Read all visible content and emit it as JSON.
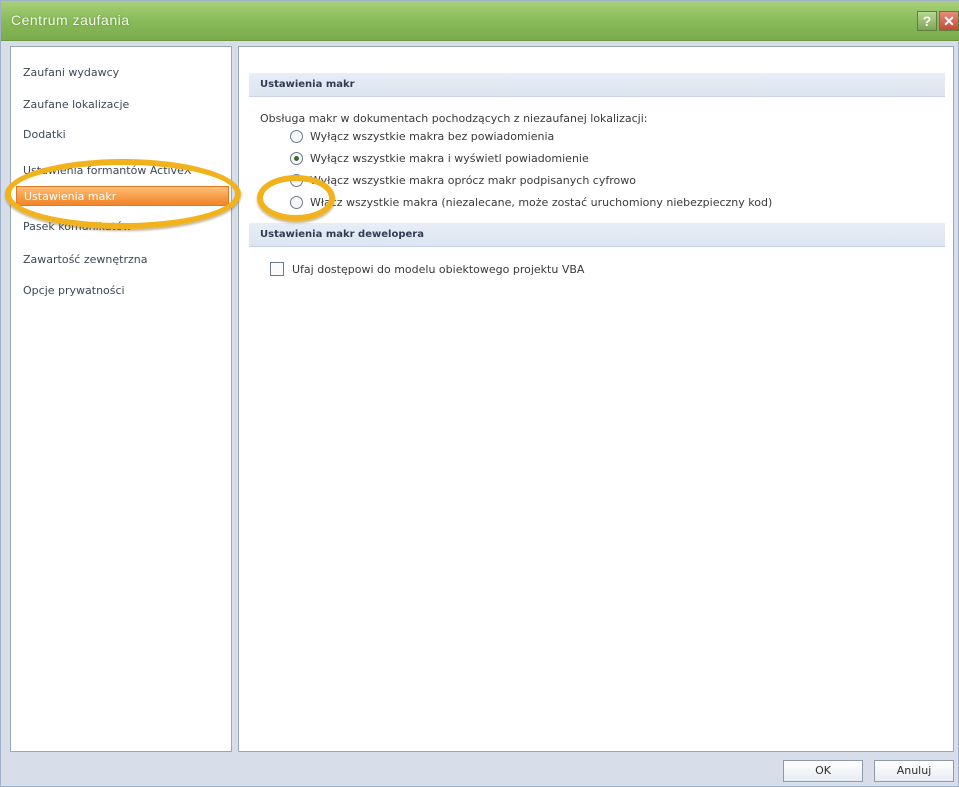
{
  "window": {
    "title": "Centrum zaufania",
    "help_label": "?",
    "close_label": "✕"
  },
  "sidebar": {
    "items": [
      {
        "label": "Zaufani wydawcy"
      },
      {
        "label": "Zaufane lokalizacje"
      },
      {
        "label": "Dodatki"
      },
      {
        "label": "Ustawienia formantów ActiveX"
      },
      {
        "label": "Ustawienia makr"
      },
      {
        "label": "Pasek komunikatów"
      },
      {
        "label": "Zawartość zewnętrzna"
      },
      {
        "label": "Opcje prywatności"
      }
    ],
    "active_index": 4
  },
  "macro_settings": {
    "header": "Ustawienia makr",
    "description": "Obsługa makr w dokumentach pochodzących z niezaufanej lokalizacji:",
    "options": [
      {
        "label": "Wyłącz wszystkie makra bez powiadomienia",
        "checked": false
      },
      {
        "label": "Wyłącz wszystkie makra i wyświetl powiadomienie",
        "checked": true
      },
      {
        "label": "Wyłącz wszystkie makra oprócz makr podpisanych cyfrowo",
        "checked": false
      },
      {
        "label": "Włącz wszystkie makra (niezalecane, może zostać uruchomiony niebezpieczny kod)",
        "checked": false
      }
    ]
  },
  "developer_settings": {
    "header": "Ustawienia makr dewelopera",
    "trust_vba_label": "Ufaj dostępowi do modelu obiektowego projektu VBA",
    "trust_vba_checked": false
  },
  "buttons": {
    "ok_label": "OK",
    "cancel_label": "Anuluj"
  },
  "annotations": {
    "highlight_color": "#f2b21b"
  }
}
